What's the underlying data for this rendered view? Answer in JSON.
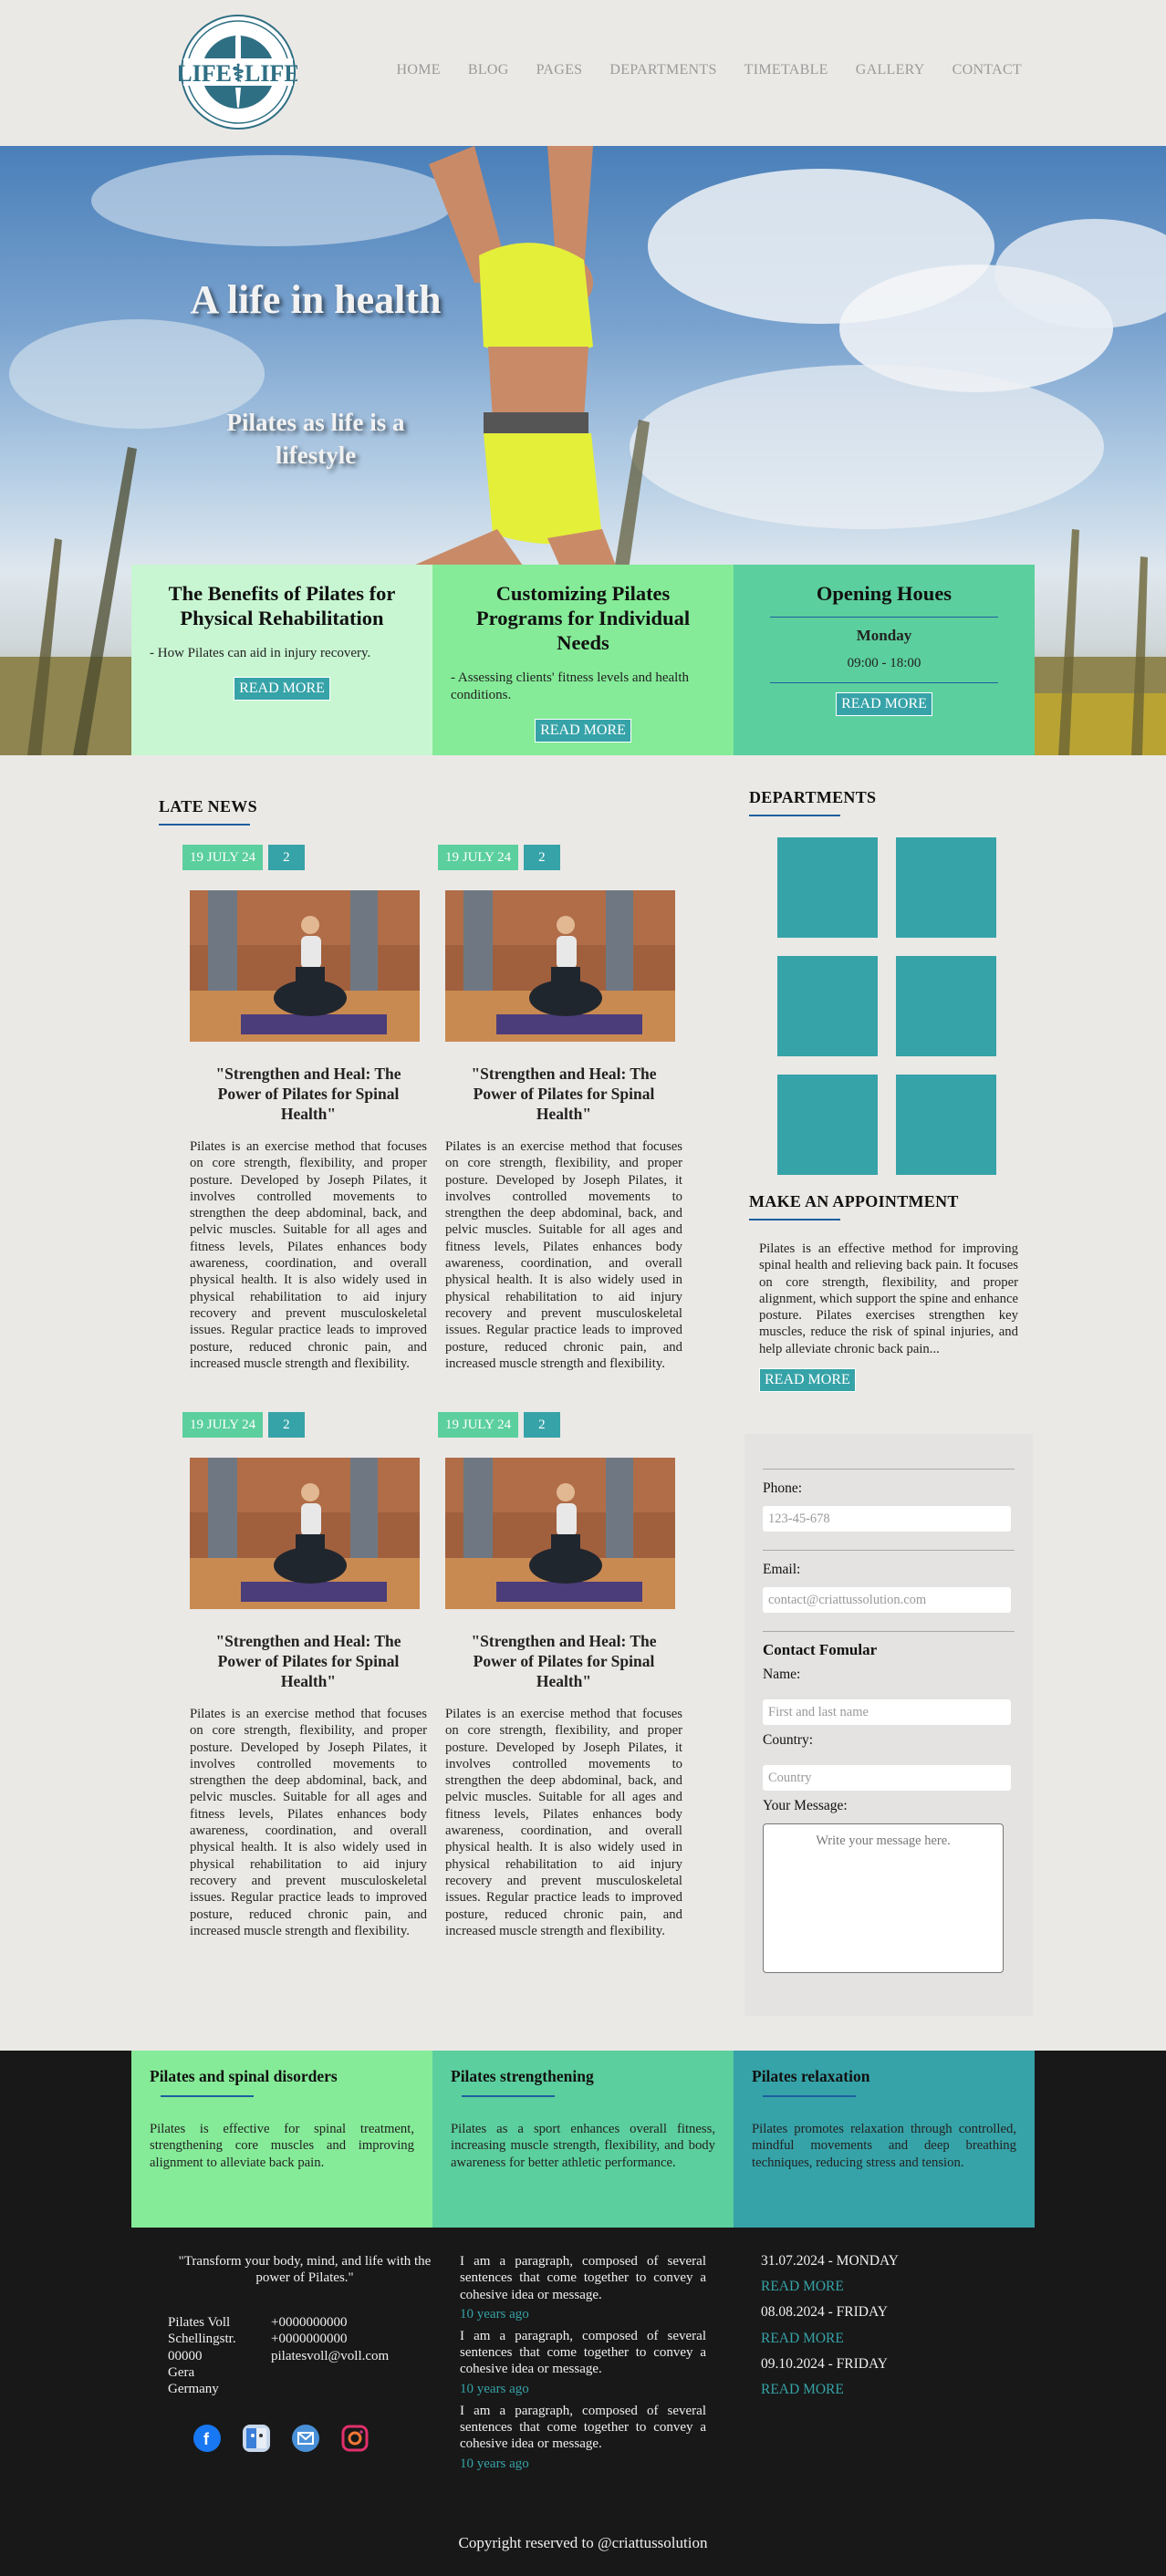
{
  "header": {
    "nav": [
      "HOME",
      "BLOG",
      "PAGES",
      "DEPARTMENTS",
      "TIMETABLE",
      "GALLERY",
      "CONTACT"
    ]
  },
  "hero": {
    "title": "A life in health",
    "subtitle": "Pilates as life is a lifestyle"
  },
  "info_boxes": [
    {
      "title": "The Benefits of Pilates for Physical Rehabilitation",
      "text": "- How Pilates can aid in injury recovery.",
      "button": "READ MORE",
      "color": "#c8f6d2"
    },
    {
      "title": "Customizing Pilates Programs for Individual Needs",
      "text": "- Assessing clients' fitness levels and health conditions.",
      "button": "READ MORE",
      "color": "#85eb98"
    },
    {
      "title": "Opening Houes",
      "day": "Monday",
      "hours": "09:00 - 18:00",
      "button": "READ MORE",
      "color": "#5bcf9d"
    }
  ],
  "news": {
    "title": "LATE NEWS",
    "posts": [
      {
        "date": "19 JULY 24",
        "count": "2",
        "title": "\"Strengthen and Heal: The Power of Pilates for Spinal Health\"",
        "body": "Pilates is an exercise method that focuses on core strength, flexibility, and proper posture. Developed by Joseph Pilates, it involves controlled movements to strengthen the deep abdominal, back, and pelvic muscles. Suitable for all ages and fitness levels, Pilates enhances body awareness, coordination, and overall physical health. It is also widely used in physical rehabilitation to aid injury recovery and prevent musculoskeletal issues. Regular practice leads to improved posture, reduced chronic pain, and increased muscle strength and flexibility."
      },
      {
        "date": "19 JULY 24",
        "count": "2",
        "title": "\"Strengthen and Heal: The Power of Pilates for Spinal Health\"",
        "body": "Pilates is an exercise method that focuses on core strength, flexibility, and proper posture. Developed by Joseph Pilates, it involves controlled movements to strengthen the deep abdominal, back, and pelvic muscles. Suitable for all ages and fitness levels, Pilates enhances body awareness, coordination, and overall physical health. It is also widely used in physical rehabilitation to aid injury recovery and prevent musculoskeletal issues. Regular practice leads to improved posture, reduced chronic pain, and increased muscle strength and flexibility."
      },
      {
        "date": "19 JULY 24",
        "count": "2",
        "title": "\"Strengthen and Heal: The Power of Pilates for Spinal Health\"",
        "body": "Pilates is an exercise method that focuses on core strength, flexibility, and proper posture. Developed by Joseph Pilates, it involves controlled movements to strengthen the deep abdominal, back, and pelvic muscles. Suitable for all ages and fitness levels, Pilates enhances body awareness, coordination, and overall physical health. It is also widely used in physical rehabilitation to aid injury recovery and prevent musculoskeletal issues. Regular practice leads to improved posture, reduced chronic pain, and increased muscle strength and flexibility."
      },
      {
        "date": "19 JULY 24",
        "count": "2",
        "title": "\"Strengthen and Heal: The Power of Pilates for Spinal Health\"",
        "body": "Pilates is an exercise method that focuses on core strength, flexibility, and proper posture. Developed by Joseph Pilates, it involves controlled movements to strengthen the deep abdominal, back, and pelvic muscles. Suitable for all ages and fitness levels, Pilates enhances body awareness, coordination, and overall physical health. It is also widely used in physical rehabilitation to aid injury recovery and prevent musculoskeletal issues. Regular practice leads to improved posture, reduced chronic pain, and increased muscle strength and flexibility."
      }
    ]
  },
  "departments": {
    "title": "DEPARTMENTS",
    "tile_color": "#36a3a8"
  },
  "appointment": {
    "title": "MAKE AN APPOINTMENT",
    "text": "Pilates is an effective method for improving spinal health and relieving back pain. It focuses on core strength, flexibility, and proper alignment, which support the spine and enhance posture. Pilates exercises strengthen key muscles, reduce the risk of spinal injuries, and help alleviate chronic back pain...",
    "button": "READ MORE"
  },
  "form": {
    "phone_label": "Phone:",
    "phone_placeholder": "123-45-678",
    "email_label": "Email:",
    "email_placeholder": "contact@criattussolution.com",
    "contact_title": "Contact Fomular",
    "name_label": "Name:",
    "name_placeholder": "First and last name",
    "country_label": "Country:",
    "country_placeholder": "Country",
    "message_label": "Your Message:",
    "message_placeholder": "Write your message here."
  },
  "feature_boxes": [
    {
      "title": "Pilates and spinal disorders",
      "text": "Pilates is effective for spinal treatment, strengthening core muscles and improving alignment to alleviate back pain.",
      "color": "#85eb98"
    },
    {
      "title": "Pilates strengthening",
      "text": "Pilates as a sport enhances overall fitness, increasing muscle strength, flexibility, and body awareness for better athletic performance.",
      "color": "#5bcf9d"
    },
    {
      "title": "Pilates relaxation",
      "text": "Pilates promotes relaxation through controlled, mindful movements and deep breathing techniques, reducing stress and tension.",
      "color": "#36a3a8"
    }
  ],
  "footer": {
    "quote": "\"Transform your body, mind, and life with the power of Pilates.\"",
    "address": [
      "Pilates Voll",
      "Schellingstr.",
      "00000",
      "Gera",
      "Germany"
    ],
    "contacts": [
      "+0000000000",
      "+0000000000",
      "pilatesvoll@voll.com"
    ],
    "posts": [
      {
        "text": "I am a paragraph, composed of several sentences that come together to convey a cohesive idea or message.",
        "time": "10 years ago"
      },
      {
        "text": "I am a paragraph, composed of several sentences that come together to convey a cohesive idea or message.",
        "time": "10 years ago"
      },
      {
        "text": "I am a paragraph, composed of several sentences that come together to convey a cohesive idea or message.",
        "time": "10 years ago"
      }
    ],
    "events": [
      {
        "date": "31.07.2024 - MONDAY",
        "link": "READ MORE"
      },
      {
        "date": "08.08.2024 - FRIDAY",
        "link": "READ MORE"
      },
      {
        "date": "09.10.2024 - FRIDAY",
        "link": "READ MORE"
      }
    ],
    "copyright": "Copyright reserved to @criattussolution",
    "social": [
      "facebook-icon",
      "finder-icon",
      "mail-icon",
      "instagram-icon"
    ]
  }
}
